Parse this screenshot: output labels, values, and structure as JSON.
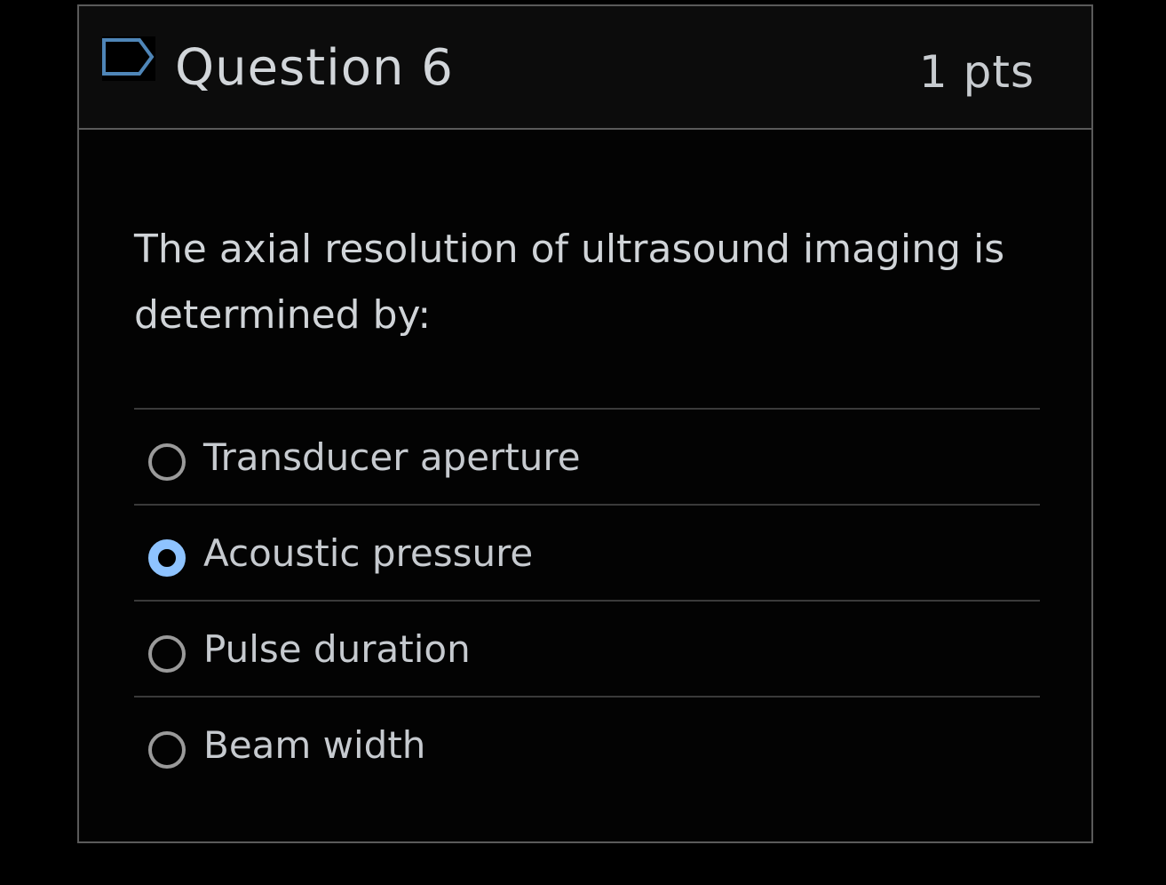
{
  "question": {
    "title": "Question 6",
    "points": "1 pts",
    "flag_icon": "flag-outline-icon",
    "text": "The axial resolution of ultrasound imaging is determined by:"
  },
  "answers": [
    {
      "label": "Transducer aperture",
      "selected": false
    },
    {
      "label": "Acoustic pressure",
      "selected": true
    },
    {
      "label": "Pulse duration",
      "selected": false
    },
    {
      "label": "Beam width",
      "selected": false
    }
  ],
  "colors": {
    "accent": "#8ec3ff",
    "flag": "#4f86b8"
  }
}
